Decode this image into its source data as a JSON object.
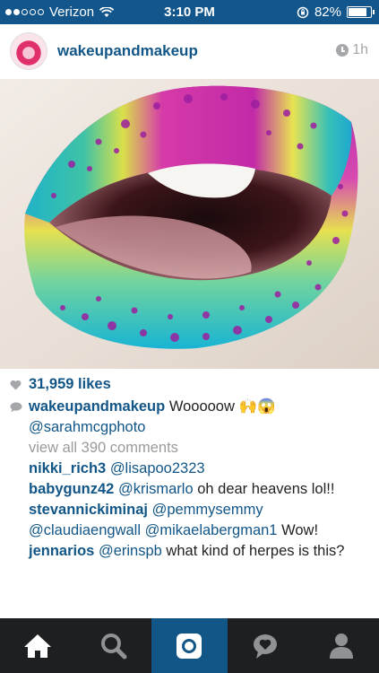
{
  "status_bar": {
    "carrier": "Verizon",
    "time": "3:10 PM",
    "battery": "82%",
    "battery_level": 0.82,
    "signal_bars": 2
  },
  "post": {
    "username": "wakeupandmakeup",
    "time_ago": "1h",
    "likes": "31,959 likes",
    "caption": {
      "username": "wakeupandmakeup",
      "text": "Wooooow",
      "emoji": "🙌😱",
      "mention": "@sarahmcgphoto"
    },
    "view_all": "view all 390 comments",
    "comments": [
      {
        "username": "nikki_rich3",
        "mention": "@lisapoo2323",
        "text": ""
      },
      {
        "username": "babygunz42",
        "mention": "@krismarlo",
        "text": "oh dear heavens lol!!"
      },
      {
        "username": "stevannickiminaj",
        "mention": "@pemmysemmy @claudiaengwall @mikaelabergman1",
        "text": "Wow!"
      },
      {
        "username": "jennarios",
        "mention": "@erinspb",
        "text": "what kind of herpes is this?"
      }
    ]
  },
  "tabbar": {
    "tabs": [
      {
        "name": "home-icon",
        "active": false
      },
      {
        "name": "search-icon",
        "active": false
      },
      {
        "name": "camera-icon",
        "active": true
      },
      {
        "name": "activity-icon",
        "active": false
      },
      {
        "name": "profile-icon",
        "active": false
      }
    ]
  },
  "colors": {
    "brand_blue": "#125688",
    "status_bar": "#12568c",
    "tabbar": "#1d1f20",
    "muted": "#a5a7aa"
  }
}
